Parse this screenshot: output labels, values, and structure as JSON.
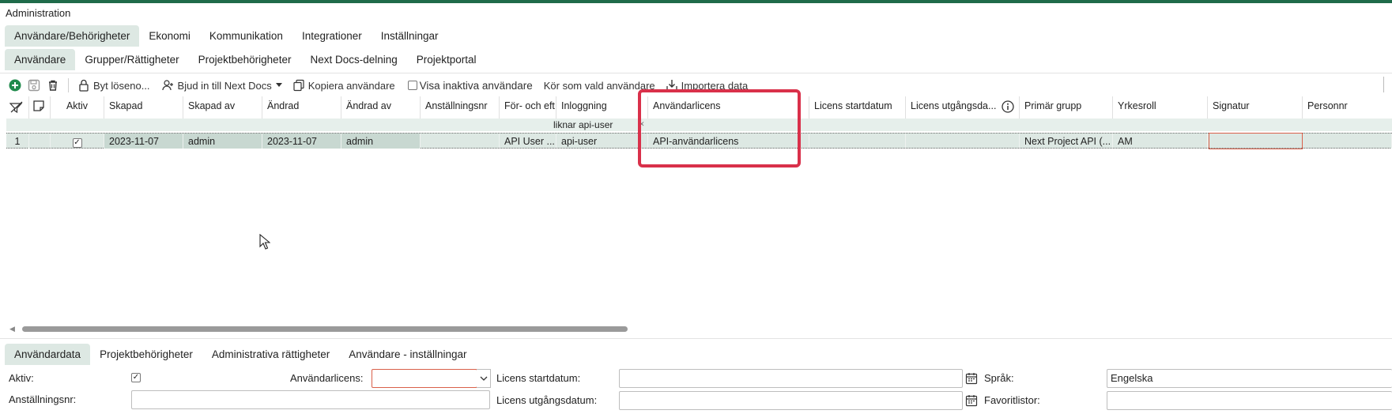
{
  "window": {
    "title": "Administration"
  },
  "main_tabs": [
    {
      "label": "Användare/Behörigheter",
      "active": true
    },
    {
      "label": "Ekonomi",
      "active": false
    },
    {
      "label": "Kommunikation",
      "active": false
    },
    {
      "label": "Integrationer",
      "active": false
    },
    {
      "label": "Inställningar",
      "active": false
    }
  ],
  "sub_tabs": [
    {
      "label": "Användare",
      "active": true
    },
    {
      "label": "Grupper/Rättigheter",
      "active": false
    },
    {
      "label": "Projektbehörigheter",
      "active": false
    },
    {
      "label": "Next Docs-delning",
      "active": false
    },
    {
      "label": "Projektportal",
      "active": false
    }
  ],
  "toolbar": {
    "change_password": "Byt löseno...",
    "invite": "Bjud in till Next Docs",
    "copy_user": "Kopiera användare",
    "show_inactive": "Visa inaktiva användare",
    "run_as": "Kör som vald användare",
    "import": "Importera data"
  },
  "grid": {
    "columns": {
      "aktiv": "Aktiv",
      "skapad": "Skapad",
      "skapad_av": "Skapad av",
      "andrad": "Ändrad",
      "andrad_av": "Ändrad av",
      "anstallningsnr": "Anställningsnr",
      "namn": "För- och eft",
      "inloggning": "Inloggning",
      "licens": "Användarlicens",
      "licens_start": "Licens startdatum",
      "licens_slut": "Licens utgångsda...",
      "primar_grupp": "Primär grupp",
      "yrkesroll": "Yrkesroll",
      "signatur": "Signatur",
      "personnr": "Personnr"
    },
    "filter": {
      "inloggning": "liknar api-user"
    },
    "rows": [
      {
        "num": "1",
        "aktiv": true,
        "skapad": "2023-11-07",
        "skapad_av": "admin",
        "andrad": "2023-11-07",
        "andrad_av": "admin",
        "anstallningsnr": "",
        "namn": "API User ...",
        "inloggning": "api-user",
        "licens": "API-användarlicens",
        "licens_start": "",
        "licens_slut": "",
        "primar_grupp": "Next Project API (...",
        "yrkesroll": "AM",
        "signatur": "",
        "personnr": ""
      }
    ]
  },
  "detail_tabs": [
    {
      "label": "Användardata",
      "active": true
    },
    {
      "label": "Projektbehörigheter",
      "active": false
    },
    {
      "label": "Administrativa rättigheter",
      "active": false
    },
    {
      "label": "Användare - inställningar",
      "active": false
    }
  ],
  "form": {
    "aktiv_label": "Aktiv:",
    "aktiv_checked": true,
    "licens_label": "Användarlicens:",
    "licens_value": "",
    "licens_start_label": "Licens startdatum:",
    "licens_start_value": "",
    "sprak_label": "Språk:",
    "sprak_value": "Engelska",
    "anstallningsnr_label": "Anställningsnr:",
    "anstallningsnr_value": "",
    "licens_slut_label": "Licens utgångsdatum:",
    "licens_slut_value": "",
    "favoritlistor_label": "Favoritlistor:",
    "favoritlistor_value": ""
  },
  "colors": {
    "accent": "#1f6b4a",
    "active_tab": "#dde8e3",
    "highlight": "#d9304a",
    "add_button": "#1f8a4c"
  }
}
